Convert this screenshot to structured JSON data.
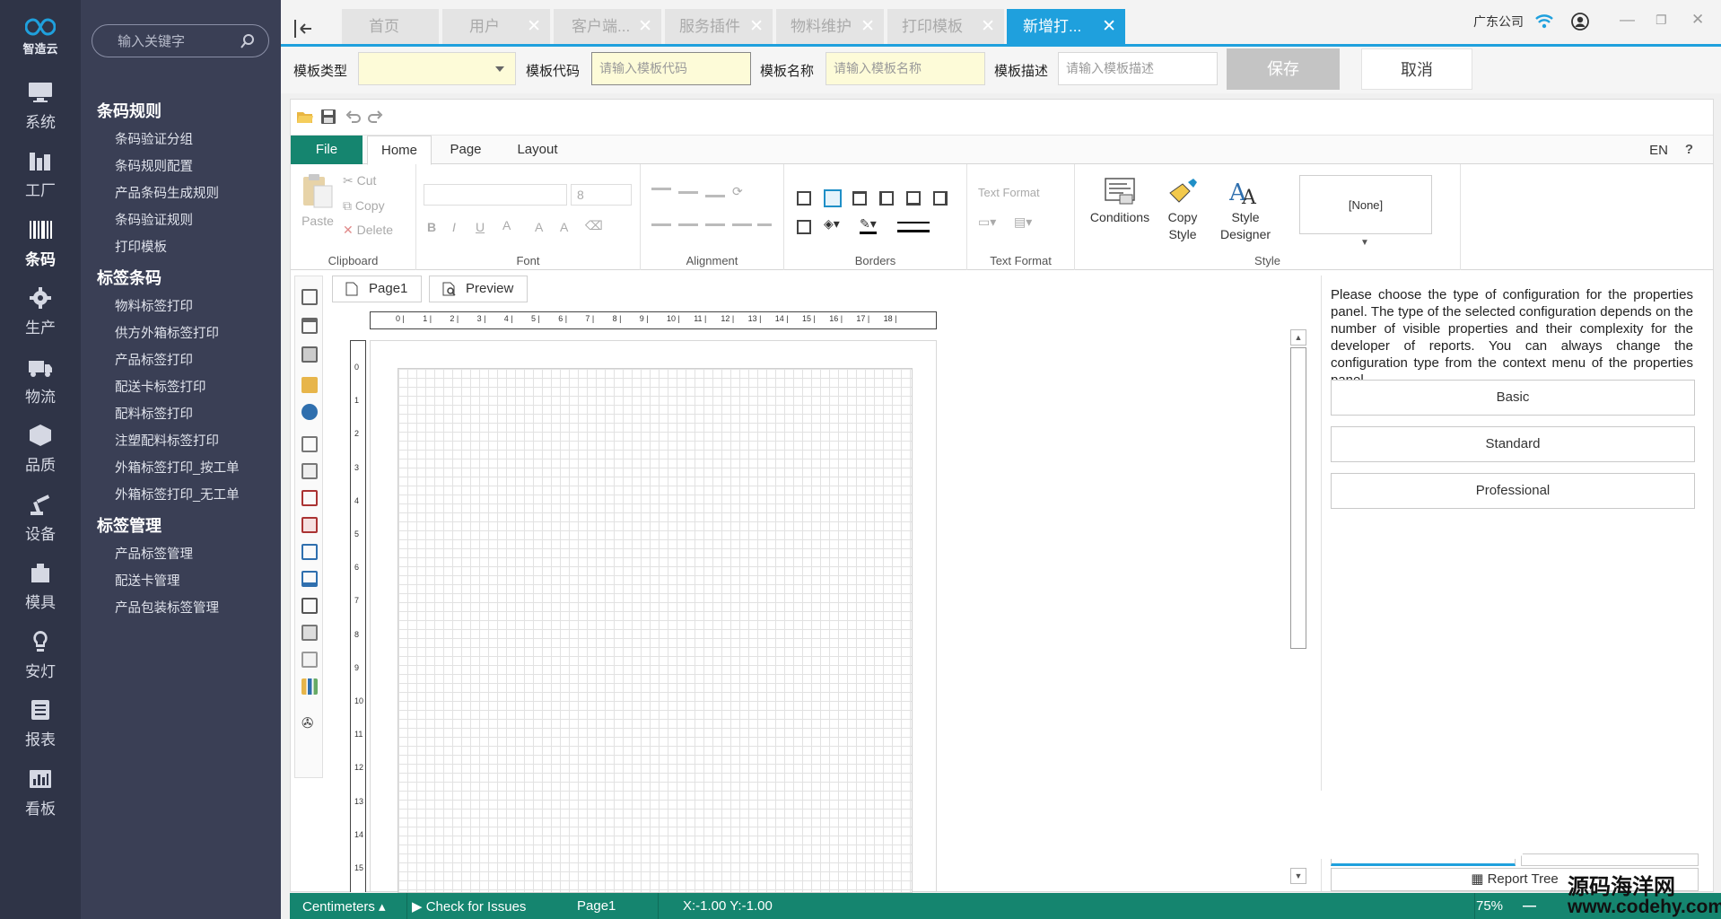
{
  "brand": {
    "name": "智造云"
  },
  "rail": [
    {
      "label": "系统",
      "icon": "monitor-icon"
    },
    {
      "label": "工厂",
      "icon": "factory-icon"
    },
    {
      "label": "条码",
      "icon": "barcode-icon",
      "active": true
    },
    {
      "label": "生产",
      "icon": "gear-icon"
    },
    {
      "label": "物流",
      "icon": "truck-icon"
    },
    {
      "label": "品质",
      "icon": "cube-icon"
    },
    {
      "label": "设备",
      "icon": "robot-arm-icon"
    },
    {
      "label": "模具",
      "icon": "mold-icon"
    },
    {
      "label": "安灯",
      "icon": "bulb-icon"
    },
    {
      "label": "报表",
      "icon": "report-icon"
    },
    {
      "label": "看板",
      "icon": "board-icon"
    }
  ],
  "search": {
    "placeholder": "输入关键字"
  },
  "menu_groups": [
    {
      "title": "条码规则",
      "items": [
        "条码验证分组",
        "条码规则配置",
        "产品条码生成规则",
        "条码验证规则",
        "打印模板"
      ]
    },
    {
      "title": "标签条码",
      "items": [
        "物料标签打印",
        "供方外箱标签打印",
        "产品标签打印",
        "配送卡标签打印",
        "配料标签打印",
        "注塑配料标签打印",
        "外箱标签打印_按工单",
        "外箱标签打印_无工单"
      ]
    },
    {
      "title": "标签管理",
      "items": [
        "产品标签管理",
        "配送卡管理",
        "产品包装标签管理"
      ]
    }
  ],
  "tabs": [
    "首页",
    "用户",
    "客户端...",
    "服务插件",
    "物料维护",
    "打印模板",
    "新增打..."
  ],
  "header": {
    "company": "广东公司"
  },
  "form": {
    "type_label": "模板类型",
    "code_label": "模板代码",
    "code_placeholder": "请输入模板代码",
    "name_label": "模板名称",
    "name_placeholder": "请输入模板名称",
    "desc_label": "模板描述",
    "desc_placeholder": "请输入模板描述",
    "save": "保存",
    "cancel": "取消"
  },
  "ribbon_tabs": {
    "file": "File",
    "home": "Home",
    "page": "Page",
    "layout": "Layout",
    "lang": "EN",
    "help": "?"
  },
  "ribbon": {
    "clipboard": {
      "name": "Clipboard",
      "paste": "Paste",
      "cut": "Cut",
      "copy": "Copy",
      "delete": "Delete"
    },
    "font": {
      "name": "Font",
      "size": "8",
      "bold": "B",
      "italic": "I",
      "underline": "U",
      "color": "A",
      "grow": "A",
      "shrink": "A"
    },
    "alignment": {
      "name": "Alignment"
    },
    "borders": {
      "name": "Borders"
    },
    "text_format": {
      "name": "Text Format",
      "label": "Text Format"
    },
    "style": {
      "name": "Style",
      "conditions": "Conditions",
      "copy_style_1": "Copy",
      "copy_style_2": "Style",
      "designer_1": "Style",
      "designer_2": "Designer",
      "none": "[None]"
    }
  },
  "page_tabs": {
    "page1": "Page1",
    "preview": "Preview"
  },
  "ruler_h": [
    "0",
    "1",
    "2",
    "3",
    "4",
    "5",
    "6",
    "7",
    "8",
    "9",
    "10",
    "11",
    "12",
    "13",
    "14",
    "15",
    "16",
    "17",
    "18"
  ],
  "ruler_v": [
    "0",
    "1",
    "2",
    "3",
    "4",
    "5",
    "6",
    "7",
    "8",
    "9",
    "10",
    "11",
    "12",
    "13",
    "14",
    "15"
  ],
  "properties": {
    "hint": "Please choose the type of configuration for the properties panel. The type of the selected configuration depends on the number of visible properties and their complexity for the developer of reports. You can always change the configuration type from the context menu of the properties panel.",
    "basic": "Basic",
    "standard": "Standard",
    "professional": "Professional",
    "report_tree": "Report Tree"
  },
  "status": {
    "units": "Centimeters",
    "check": "Check for Issues",
    "page": "Page1",
    "coords": "X:-1.00  Y:-1.00",
    "zoom": "75%"
  },
  "watermark": {
    "line1": "源码海洋网",
    "line2": "www.codehy.com"
  },
  "colors": {
    "accent": "#1fa0dd",
    "ribbon_green": "#15856f",
    "rail_bg": "#2f3447",
    "menu_bg": "#3a3f55"
  }
}
